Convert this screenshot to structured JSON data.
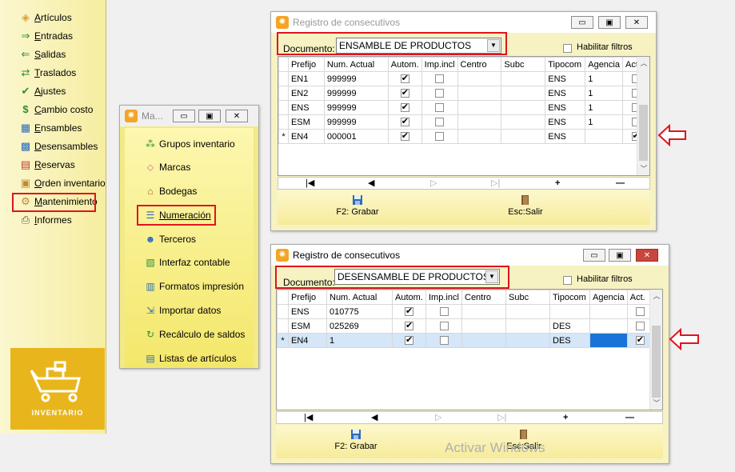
{
  "sidebar": {
    "items": [
      {
        "label": "Artículos",
        "icon": "box-icon"
      },
      {
        "label": "Entradas",
        "icon": "arrow-right-icon"
      },
      {
        "label": "Salidas",
        "icon": "arrow-left-icon"
      },
      {
        "label": "Traslados",
        "icon": "swap-icon"
      },
      {
        "label": "Ajustes",
        "icon": "check-icon"
      },
      {
        "label": "Cambio costo",
        "icon": "dollar-icon"
      },
      {
        "label": "Ensambles",
        "icon": "assembly-icon"
      },
      {
        "label": "Desensambles",
        "icon": "disassembly-icon"
      },
      {
        "label": "Reservas",
        "icon": "reserve-icon"
      },
      {
        "label": "Orden inventario",
        "icon": "order-icon"
      },
      {
        "label": "Mantenimiento",
        "icon": "gear-icon"
      },
      {
        "label": "Informes",
        "icon": "printer-icon"
      }
    ],
    "module_label": "INVENTARIO"
  },
  "mant_window": {
    "title": "Ma...",
    "items": [
      {
        "label": "Grupos inventario"
      },
      {
        "label": "Marcas"
      },
      {
        "label": "Bodegas"
      },
      {
        "label": "Numeración"
      },
      {
        "label": "Terceros"
      },
      {
        "label": "Interfaz contable"
      },
      {
        "label": "Formatos impresión"
      },
      {
        "label": "Importar datos"
      },
      {
        "label": "Recálculo de saldos"
      },
      {
        "label": "Listas de artículos"
      }
    ]
  },
  "reg_top": {
    "title": "Registro de consecutivos",
    "doc_label": "Documento:",
    "doc_value": "ENSAMBLE DE PRODUCTOS",
    "filter_label": "Habilitar filtros",
    "columns": [
      "Prefijo",
      "Num. Actual",
      "Autom.",
      "Imp.incl",
      "Centro",
      "Subc",
      "Tipocom",
      "Agencia",
      "Act."
    ],
    "rows": [
      {
        "marker": "",
        "prefijo": "EN1",
        "num": "999999",
        "autom": true,
        "imp": false,
        "centro": "",
        "subc": "",
        "tipocom": "ENS",
        "agencia": "1",
        "act": false
      },
      {
        "marker": "",
        "prefijo": "EN2",
        "num": "999999",
        "autom": true,
        "imp": false,
        "centro": "",
        "subc": "",
        "tipocom": "ENS",
        "agencia": "1",
        "act": false
      },
      {
        "marker": "",
        "prefijo": "ENS",
        "num": "999999",
        "autom": true,
        "imp": false,
        "centro": "",
        "subc": "",
        "tipocom": "ENS",
        "agencia": "1",
        "act": false
      },
      {
        "marker": "",
        "prefijo": "ESM",
        "num": "999999",
        "autom": true,
        "imp": false,
        "centro": "",
        "subc": "",
        "tipocom": "ENS",
        "agencia": "1",
        "act": false
      },
      {
        "marker": "*",
        "prefijo": "EN4",
        "num": "000001",
        "autom": true,
        "imp": false,
        "centro": "",
        "subc": "",
        "tipocom": "ENS",
        "agencia": "",
        "act": true
      }
    ],
    "nav": [
      "|◀",
      "◀",
      "▷",
      "▷|",
      "+",
      "—"
    ],
    "save_label": "F2: Grabar",
    "exit_label": "Esc:Salir"
  },
  "reg_bottom": {
    "title": "Registro de consecutivos",
    "doc_label": "Documento:",
    "doc_value": "DESENSAMBLE DE PRODUCTOS",
    "filter_label": "Habilitar filtros",
    "columns": [
      "Prefijo",
      "Num. Actual",
      "Autom.",
      "Imp.incl",
      "Centro",
      "Subc",
      "Tipocom",
      "Agencia",
      "Act."
    ],
    "rows": [
      {
        "marker": "",
        "prefijo": "ENS",
        "num": "010775",
        "autom": true,
        "imp": false,
        "centro": "",
        "subc": "",
        "tipocom": "",
        "agencia": "",
        "act": false
      },
      {
        "marker": "",
        "prefijo": "ESM",
        "num": "025269",
        "autom": true,
        "imp": false,
        "centro": "",
        "subc": "",
        "tipocom": "DES",
        "agencia": "",
        "act": false
      },
      {
        "marker": "*",
        "prefijo": "EN4",
        "num": "1",
        "autom": true,
        "imp": false,
        "centro": "",
        "subc": "",
        "tipocom": "DES",
        "agencia": "",
        "act": true
      }
    ],
    "nav": [
      "|◀",
      "◀",
      "▷",
      "▷|",
      "+",
      "—"
    ],
    "save_label": "F2: Grabar",
    "exit_label": "Esc:Salir"
  },
  "watermark": "Activar Windows",
  "colors": {
    "highlight_red": "#e0141e",
    "window_yellow": "#f7f2c2",
    "selected_cell": "#1a73d9",
    "selected_row": "#d4e6f7"
  }
}
